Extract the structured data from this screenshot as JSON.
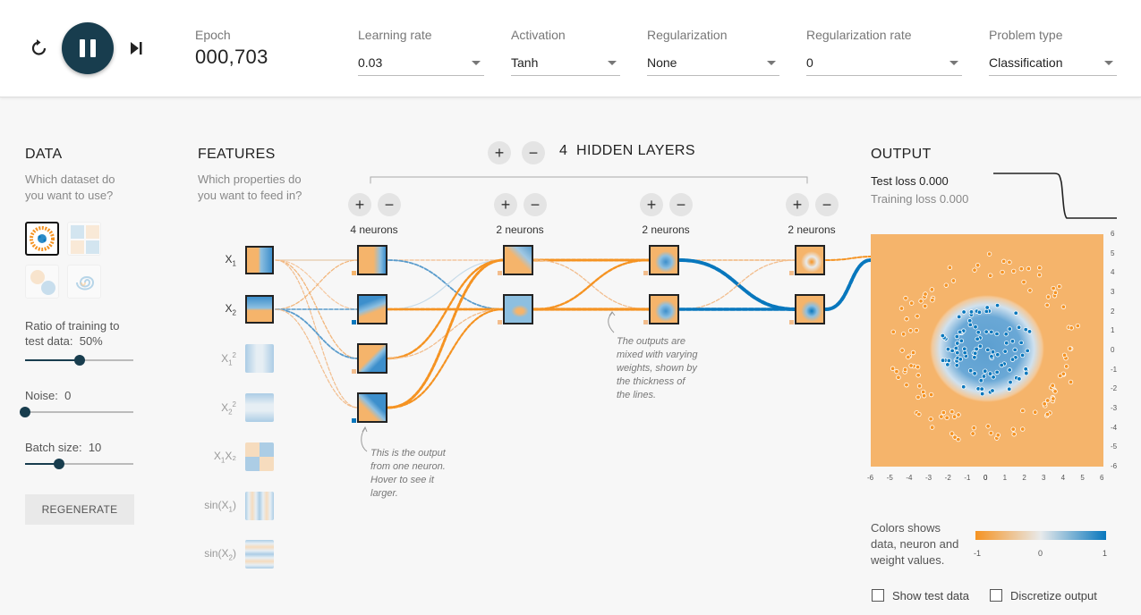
{
  "controls": {
    "epoch_label": "Epoch",
    "epoch_value": "000,703",
    "learning_rate": {
      "label": "Learning rate",
      "value": "0.03"
    },
    "activation": {
      "label": "Activation",
      "value": "Tanh"
    },
    "regularization": {
      "label": "Regularization",
      "value": "None"
    },
    "regularization_rate": {
      "label": "Regularization rate",
      "value": "0"
    },
    "problem_type": {
      "label": "Problem type",
      "value": "Classification"
    }
  },
  "data": {
    "title": "DATA",
    "question": [
      "Which dataset do",
      "you want to use?"
    ],
    "ratio_label": [
      "Ratio of training to",
      "test data:"
    ],
    "ratio_value": "50%",
    "ratio_fraction": 0.5,
    "noise_label": "Noise:",
    "noise_value": "0",
    "noise_fraction": 0.0,
    "batch_label": "Batch size:",
    "batch_value": "10",
    "batch_fraction": 0.31,
    "regenerate_label": "REGENERATE"
  },
  "features": {
    "title": "FEATURES",
    "question": [
      "Which properties do",
      "you want to feed in?"
    ],
    "items": [
      {
        "base": "X",
        "sub": "1",
        "sup": "",
        "tail": "",
        "active": true
      },
      {
        "base": "X",
        "sub": "2",
        "sup": "",
        "tail": "",
        "active": true
      },
      {
        "base": "X",
        "sub": "1",
        "sup": "2",
        "tail": "",
        "active": false
      },
      {
        "base": "X",
        "sub": "2",
        "sup": "2",
        "tail": "",
        "active": false
      },
      {
        "base": "X",
        "sub": "1",
        "sup": "",
        "tail": "X₂",
        "active": false
      },
      {
        "base": "sin(X",
        "sub": "1",
        "sup": "",
        "tail": ")",
        "active": false
      },
      {
        "base": "sin(X",
        "sub": "2",
        "sup": "",
        "tail": ")",
        "active": false
      }
    ]
  },
  "network": {
    "layer_count": "4",
    "layers_label": "HIDDEN LAYERS",
    "layers": [
      {
        "neurons": "4 neurons"
      },
      {
        "neurons": "2 neurons"
      },
      {
        "neurons": "2 neurons"
      },
      {
        "neurons": "2 neurons"
      }
    ],
    "plus": "+",
    "minus": "−",
    "note_neuron": [
      "This is the output",
      "from one neuron.",
      "Hover to see it",
      "larger."
    ],
    "note_weights": [
      "The outputs are",
      "mixed with varying",
      "weights, shown by",
      "the thickness of",
      "the lines."
    ]
  },
  "output": {
    "title": "OUTPUT",
    "test_loss": "Test loss 0.000",
    "training_loss": "Training loss 0.000",
    "axis_ticks": [
      "-6",
      "-5",
      "-4",
      "-3",
      "-2",
      "-1",
      "0",
      "1",
      "2",
      "3",
      "4",
      "5",
      "6"
    ],
    "y_axis_ticks": [
      "6",
      "5",
      "4",
      "3",
      "2",
      "1",
      "0",
      "-1",
      "-2",
      "-3",
      "-4",
      "-5",
      "-6"
    ],
    "legend_text": [
      "Colors shows",
      "data, neuron and",
      "weight values."
    ],
    "legend_ticks": [
      "-1",
      "0",
      "1"
    ],
    "show_test_data": "Show test data",
    "discretize_output": "Discretize output"
  },
  "colors": {
    "orange": "#f59322",
    "blue": "#0877bd",
    "dark": "#183d4e"
  }
}
